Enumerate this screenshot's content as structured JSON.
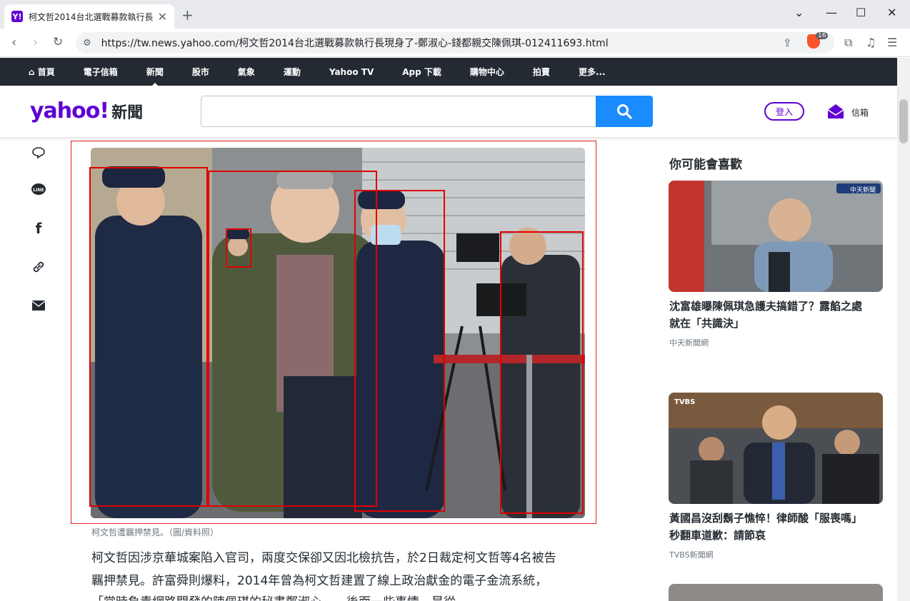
{
  "browser": {
    "tab_title": "柯文哲2014台北選戰募款執行長",
    "tab_favicon": "Y!",
    "url": "https://tw.news.yahoo.com/柯文哲2014台北選戰募款執行長現身了-鄭淑心-錢都親交陳佩琪-012411693.html",
    "brave_badge": "16"
  },
  "nav": {
    "items": [
      "首頁",
      "電子信箱",
      "新聞",
      "股市",
      "氣象",
      "運動",
      "Yahoo TV",
      "App 下載",
      "購物中心",
      "拍賣",
      "更多..."
    ],
    "active": "新聞"
  },
  "header": {
    "logo_text": "yahoo!",
    "logo_section": "新聞",
    "search_placeholder": "",
    "login_label": "登入",
    "mail_label": "信箱"
  },
  "article": {
    "caption": "柯文哲遭羈押禁見。（圖/資料照）",
    "paragraphs": [
      "柯文哲因涉京華城案陷入官司，兩度交保卻又因北檢抗告，於2日裁定柯文哲等4名被告",
      "羈押禁見。許富舜則爆料，2014年曾為柯文哲建置了線上政治獻金的電子金流系統，",
      "「當時負責網路開發的陳佩琪的秘書鄭淑心……後面一些事情，是從"
    ]
  },
  "sidebar": {
    "heading": "你可能會喜歡",
    "cards": [
      {
        "title_line1": "沈富雄曝陳佩琪急護夫搞錯了？露餡之處",
        "title_line2": "就在「共識決」",
        "source": "中天新聞網",
        "img_tag": "中天新聞"
      },
      {
        "title_line1": "黃國昌沒刮鬍子憔悴！律師酸「服喪嗎」",
        "title_line2": "秒翻車道歉：請節哀",
        "source": "TVBS新聞網",
        "img_tag": "TVBS"
      }
    ]
  },
  "colors": {
    "brand": "#6001d2",
    "nav_bg": "#232a31",
    "search_btn": "#1a8cff",
    "annotation": "#e00000"
  }
}
